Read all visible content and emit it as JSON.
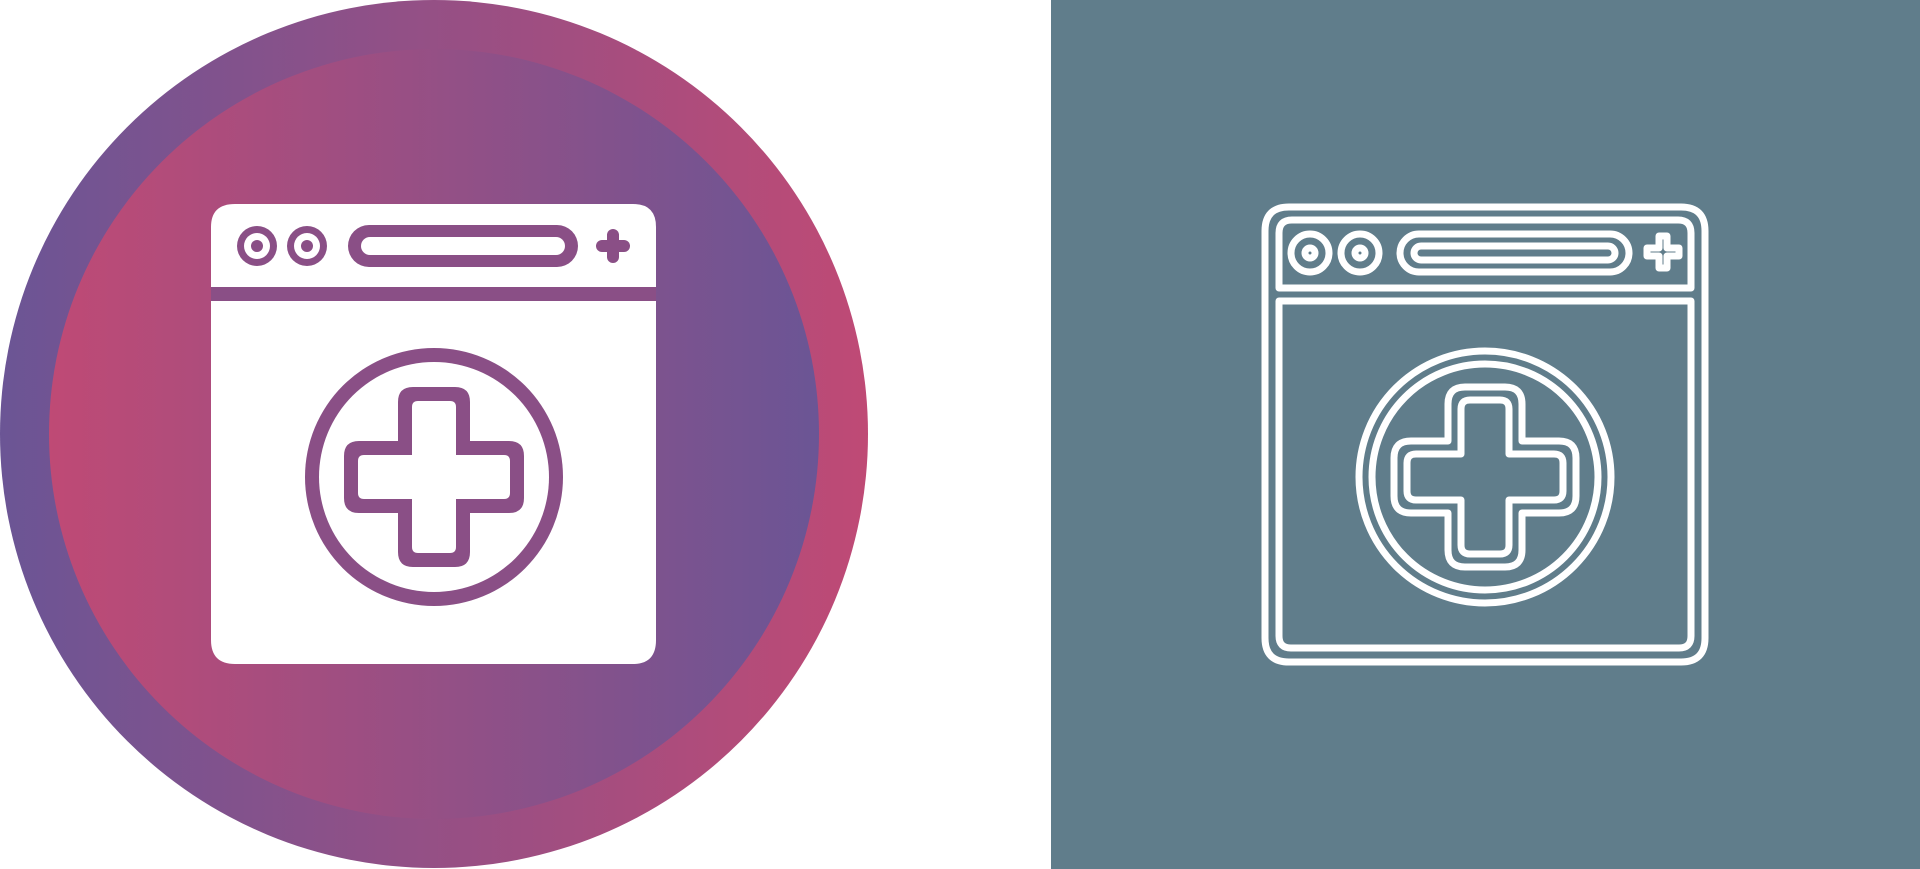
{
  "variants": [
    {
      "style": "glyph",
      "icon": "medical-browser-icon",
      "background_shape": "circle",
      "gradient_colors": [
        "#6b5595",
        "#bf4a75"
      ],
      "glyph_color": "#ffffff"
    },
    {
      "style": "outline",
      "icon": "medical-browser-icon",
      "background_shape": "square",
      "background_color": "#607d8b",
      "stroke_color": "#ffffff"
    }
  ]
}
